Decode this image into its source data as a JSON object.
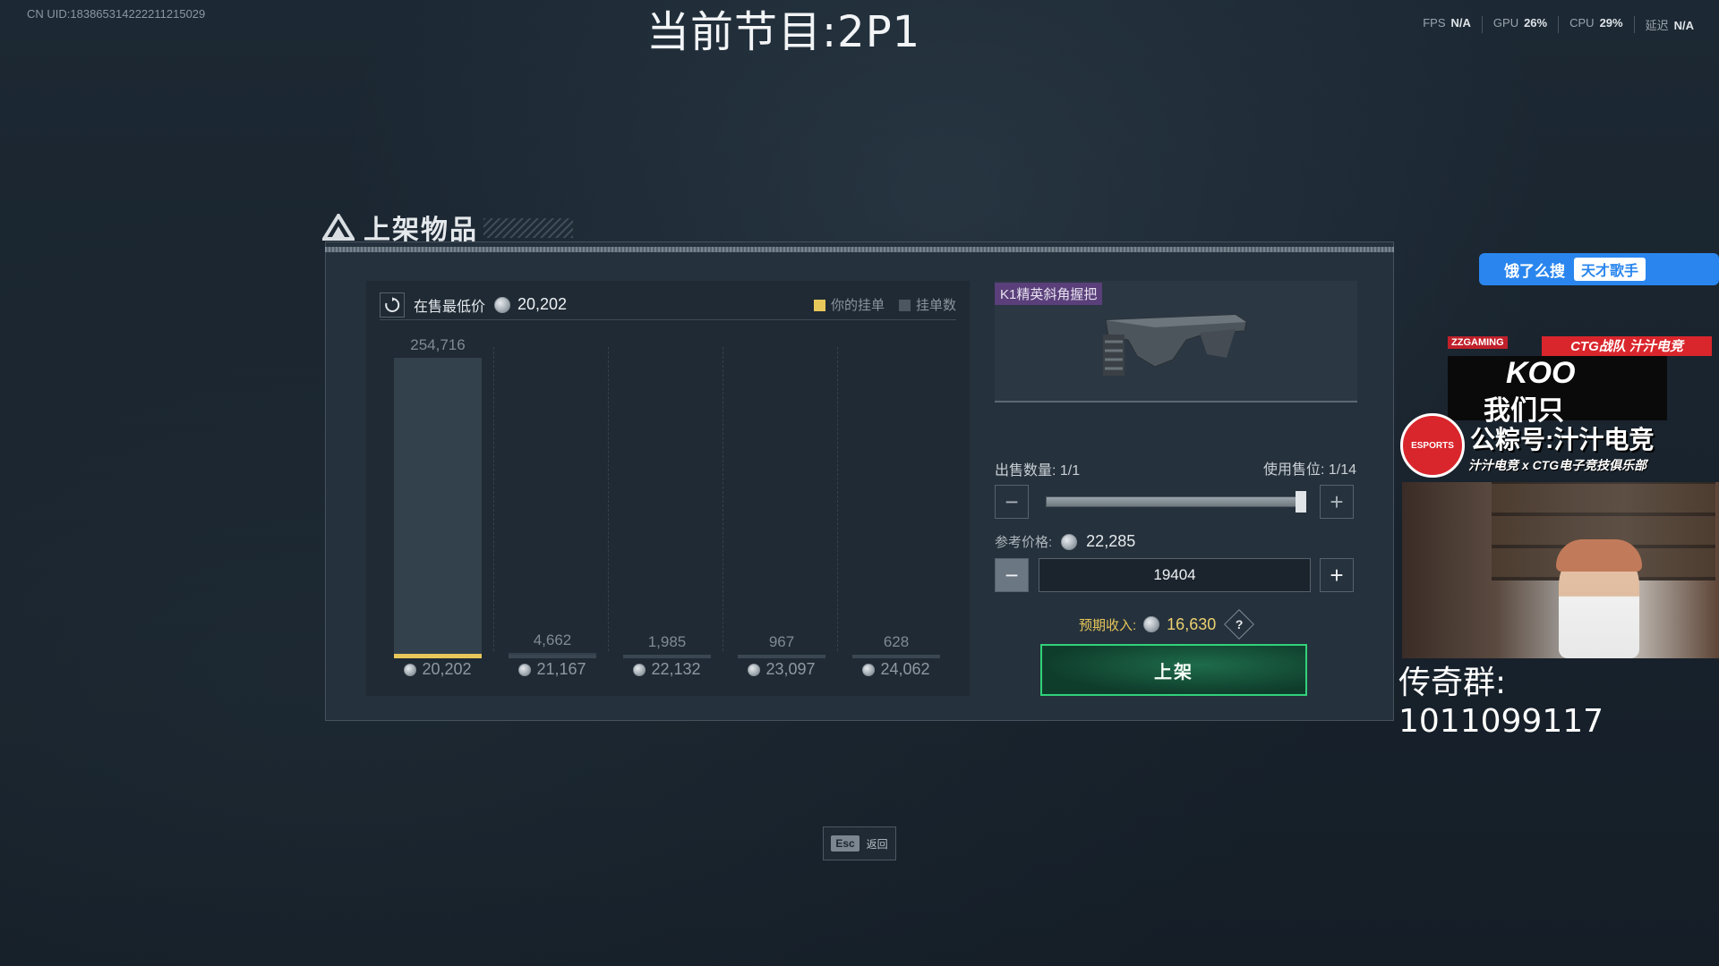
{
  "hud": {
    "uid": "CN UID:18386531422221121502​9",
    "stream_title": "当前节目:2P1",
    "perf": [
      {
        "label": "FPS",
        "value": "N/A"
      },
      {
        "label": "GPU",
        "value": "26%"
      },
      {
        "label": "CPU",
        "value": "29%"
      },
      {
        "label": "延迟",
        "value": "N/A"
      }
    ]
  },
  "panel": {
    "title": "上架物品",
    "chart": {
      "lowest_label": "在售最低价",
      "lowest_value": "20,202",
      "legend": [
        {
          "label": "你的挂单",
          "color": "#e8c85a"
        },
        {
          "label": "挂单数",
          "color": "#4b5661"
        }
      ]
    },
    "item": {
      "name": "K1精英斜角握把"
    },
    "quantity": {
      "label": "出售数量:",
      "value": "1/1",
      "slot_label": "使用售位:",
      "slot_value": "1/14",
      "slider_fraction": 1.0
    },
    "price": {
      "ref_label": "参考价格:",
      "ref_value": "22,285",
      "input_value": "19404"
    },
    "income": {
      "label": "预期收入:",
      "value": "16,630",
      "help": "?"
    },
    "list_button": "上架",
    "esc": {
      "key": "Esc",
      "label": "返回"
    }
  },
  "chart_data": {
    "type": "bar",
    "title": "",
    "xlabel": "",
    "ylabel": "",
    "categories": [
      "20,202",
      "21,167",
      "22,132",
      "23,097",
      "24,062"
    ],
    "values": [
      254716,
      4662,
      1985,
      967,
      628
    ],
    "value_labels": [
      "254,716",
      "4,662",
      "1,985",
      "967",
      "628"
    ],
    "highlight_index": 0,
    "highlight_color": "#e8c85a",
    "ylim": [
      0,
      254716
    ]
  },
  "overlay": {
    "search_text": "饿了么搜",
    "search_tag": "天才歌手",
    "promo_zz": "ZZGAMING",
    "promo_red": "CTG战队 汁汁电竞",
    "promo_koo": "KOO",
    "promo_we": "我们只",
    "promo_badge": "ESPORTS",
    "promo_gzh": "公粽号:汁汁电竞",
    "promo_sub": "汁汁电竞 x CTG电子竞技俱乐部",
    "group_text": "传奇群: 1011099117"
  }
}
